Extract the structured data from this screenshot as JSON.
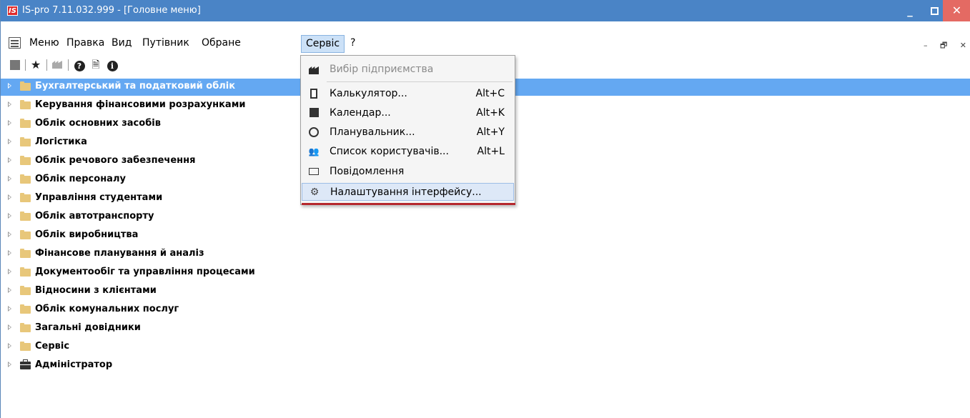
{
  "window": {
    "app_logo": "IS",
    "title": "IS-pro 7.11.032.999 - [Головне меню]",
    "min_symbol": "_",
    "close_symbol": "✕"
  },
  "menubar": {
    "items": [
      "Меню",
      "Правка",
      "Вид",
      "Путівник",
      "Обране",
      "Сервіс",
      "?"
    ],
    "active": "Сервіс",
    "mdi_controls": [
      "–",
      "🗗",
      "✕"
    ]
  },
  "toolbar": {
    "icons": [
      "page-icon",
      "star-icon",
      "factory-icon",
      "help-icon",
      "document-info-icon",
      "info-icon"
    ]
  },
  "tree": {
    "items": [
      {
        "label": "Бухгалтерський та податковий облік",
        "icon": "folder-icon",
        "selected": true
      },
      {
        "label": "Керування фінансовими розрахунками",
        "icon": "folder-icon"
      },
      {
        "label": "Облік основних засобів",
        "icon": "folder-icon"
      },
      {
        "label": "Логістика",
        "icon": "folder-icon"
      },
      {
        "label": "Облік речового забезпечення",
        "icon": "folder-icon"
      },
      {
        "label": "Облік персоналу",
        "icon": "folder-icon"
      },
      {
        "label": "Управління студентами",
        "icon": "folder-icon"
      },
      {
        "label": "Облік автотранспорту",
        "icon": "folder-icon"
      },
      {
        "label": "Облік виробництва",
        "icon": "folder-icon"
      },
      {
        "label": "Фінансове планування й аналіз",
        "icon": "folder-icon"
      },
      {
        "label": "Документообіг та управління процесами",
        "icon": "folder-icon"
      },
      {
        "label": "Відносини з клієнтами",
        "icon": "folder-icon"
      },
      {
        "label": "Облік комунальних послуг",
        "icon": "folder-icon"
      },
      {
        "label": "Загальні довідники",
        "icon": "folder-icon"
      },
      {
        "label": "Сервіс",
        "icon": "folder-icon"
      },
      {
        "label": "Адміністратор",
        "icon": "briefcase-icon"
      }
    ]
  },
  "service_menu": {
    "items": [
      {
        "label": "Вибір підприємства",
        "shortcut": "",
        "icon": "factory-icon",
        "disabled": true
      },
      {
        "label": "Калькулятор...",
        "shortcut": "Alt+C",
        "icon": "calculator-icon"
      },
      {
        "label": "Календар...",
        "shortcut": "Alt+K",
        "icon": "calendar-icon"
      },
      {
        "label": "Планувальник...",
        "shortcut": "Alt+Y",
        "icon": "clock-icon"
      },
      {
        "label": "Список користувачів...",
        "shortcut": "Alt+L",
        "icon": "users-icon"
      },
      {
        "label": "Повідомлення",
        "shortcut": "",
        "icon": "mail-icon"
      },
      {
        "label": "Налаштування інтерфейсу...",
        "shortcut": "",
        "icon": "gears-icon",
        "highlighted": true
      }
    ]
  },
  "colors": {
    "titlebar": "#4a84c6",
    "selection": "#64a8f2",
    "folder": "#e8c77a",
    "close_button": "#e46a63",
    "underline": "#b5272d"
  }
}
